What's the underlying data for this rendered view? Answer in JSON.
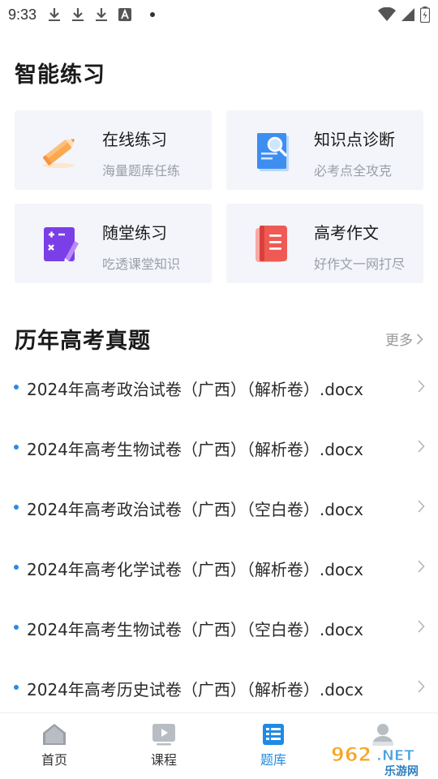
{
  "status_bar": {
    "time": "9:33",
    "left_icons": [
      "download-icon",
      "download-icon",
      "download-icon",
      "font-a-icon"
    ],
    "right_icons": [
      "wifi-icon",
      "signal-icon",
      "battery-charging-icon"
    ]
  },
  "practice": {
    "title": "智能练习",
    "cards": [
      {
        "title": "在线练习",
        "subtitle": "海量题库任练",
        "icon": "pencil-icon"
      },
      {
        "title": "知识点诊断",
        "subtitle": "必考点全攻克",
        "icon": "document-search-icon"
      },
      {
        "title": "随堂练习",
        "subtitle": "吃透课堂知识",
        "icon": "quiz-board-icon"
      },
      {
        "title": "高考作文",
        "subtitle": "好作文一网打尽",
        "icon": "notebook-icon"
      }
    ]
  },
  "exams": {
    "title": "历年高考真题",
    "more_label": "更多",
    "items": [
      "2024年高考政治试卷（广西）（解析卷）.docx",
      "2024年高考生物试卷（广西）（解析卷）.docx",
      "2024年高考政治试卷（广西）（空白卷）.docx",
      "2024年高考化学试卷（广西）（解析卷）.docx",
      "2024年高考生物试卷（广西）（空白卷）.docx",
      "2024年高考历史试卷（广西）（解析卷）.docx"
    ]
  },
  "bottom_nav": {
    "items": [
      {
        "label": "首页",
        "icon": "home-icon"
      },
      {
        "label": "课程",
        "icon": "video-play-icon"
      },
      {
        "label": "题库",
        "icon": "question-bank-icon",
        "active": true
      },
      {
        "label": "",
        "icon": "profile-icon"
      }
    ]
  },
  "watermark": {
    "brand": "962.NET",
    "sub": "乐游网"
  },
  "colors": {
    "accent": "#1f8ae5",
    "card_bg": "#f3f5fa",
    "bullet": "#2b8be6",
    "subtitle": "#9a9fa8"
  }
}
